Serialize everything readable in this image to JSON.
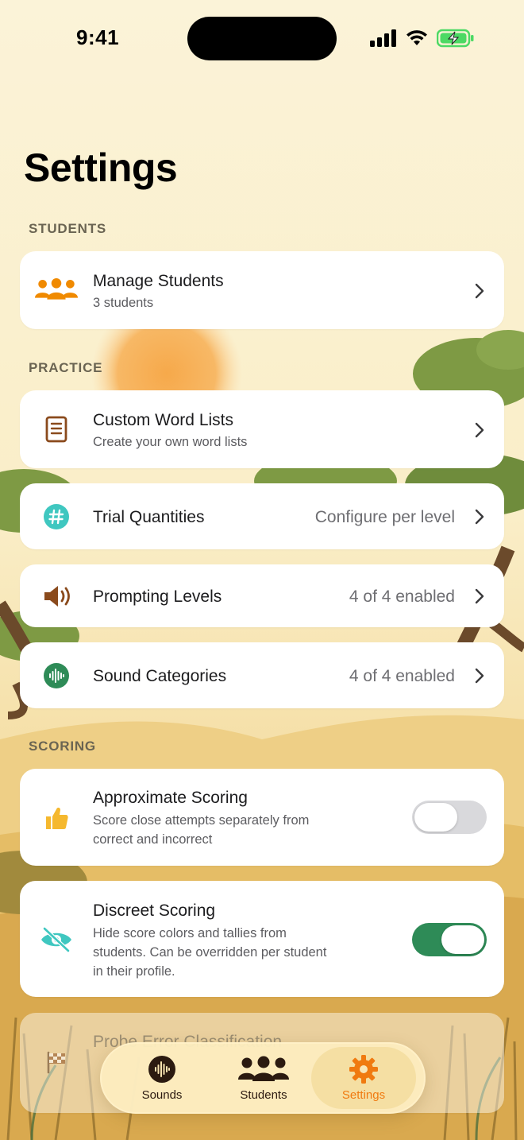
{
  "status_bar": {
    "time": "9:41"
  },
  "page": {
    "title": "Settings"
  },
  "sections": {
    "students": "STUDENTS",
    "practice": "PRACTICE",
    "scoring": "SCORING"
  },
  "rows": {
    "manage_students": {
      "title": "Manage Students",
      "subtitle": "3 students",
      "icon": "people-icon",
      "color": "#f08a00"
    },
    "custom_word_lists": {
      "title": "Custom Word Lists",
      "subtitle": "Create your own word lists",
      "icon": "list-icon",
      "color": "#8a4a1c"
    },
    "trial_quantities": {
      "title": "Trial Quantities",
      "value": "Configure per level",
      "icon": "hash-icon",
      "color": "#3fc7c0"
    },
    "prompting_levels": {
      "title": "Prompting Levels",
      "value": "4 of 4 enabled",
      "icon": "speaker-icon",
      "color": "#8a4a1c"
    },
    "sound_categories": {
      "title": "Sound Categories",
      "value": "4 of 4 enabled",
      "icon": "waveform-icon",
      "color": "#2e8b57"
    },
    "approximate_scoring": {
      "title": "Approximate Scoring",
      "subtitle_line1": "Score close attempts separately from",
      "subtitle_line2": "correct and incorrect",
      "icon": "thumbs-up-icon",
      "color": "#f5b82e",
      "enabled": false
    },
    "discreet_scoring": {
      "title": "Discreet Scoring",
      "subtitle_line1": "Hide score colors and tallies from",
      "subtitle_line2": "students. Can be overridden per student",
      "subtitle_line3": "in their profile.",
      "icon": "eye-slash-icon",
      "color": "#3fc7c0",
      "enabled": true
    },
    "probe_error": {
      "title": "Probe Error Classification",
      "icon": "flag-icon"
    }
  },
  "tabbar": {
    "tabs": [
      {
        "label": "Sounds",
        "icon": "waveform-icon",
        "active": false
      },
      {
        "label": "Students",
        "icon": "people-icon",
        "active": false
      },
      {
        "label": "Settings",
        "icon": "gear-icon",
        "active": true
      }
    ],
    "active_color": "#f07a10",
    "inactive_color": "#2b1a10"
  }
}
